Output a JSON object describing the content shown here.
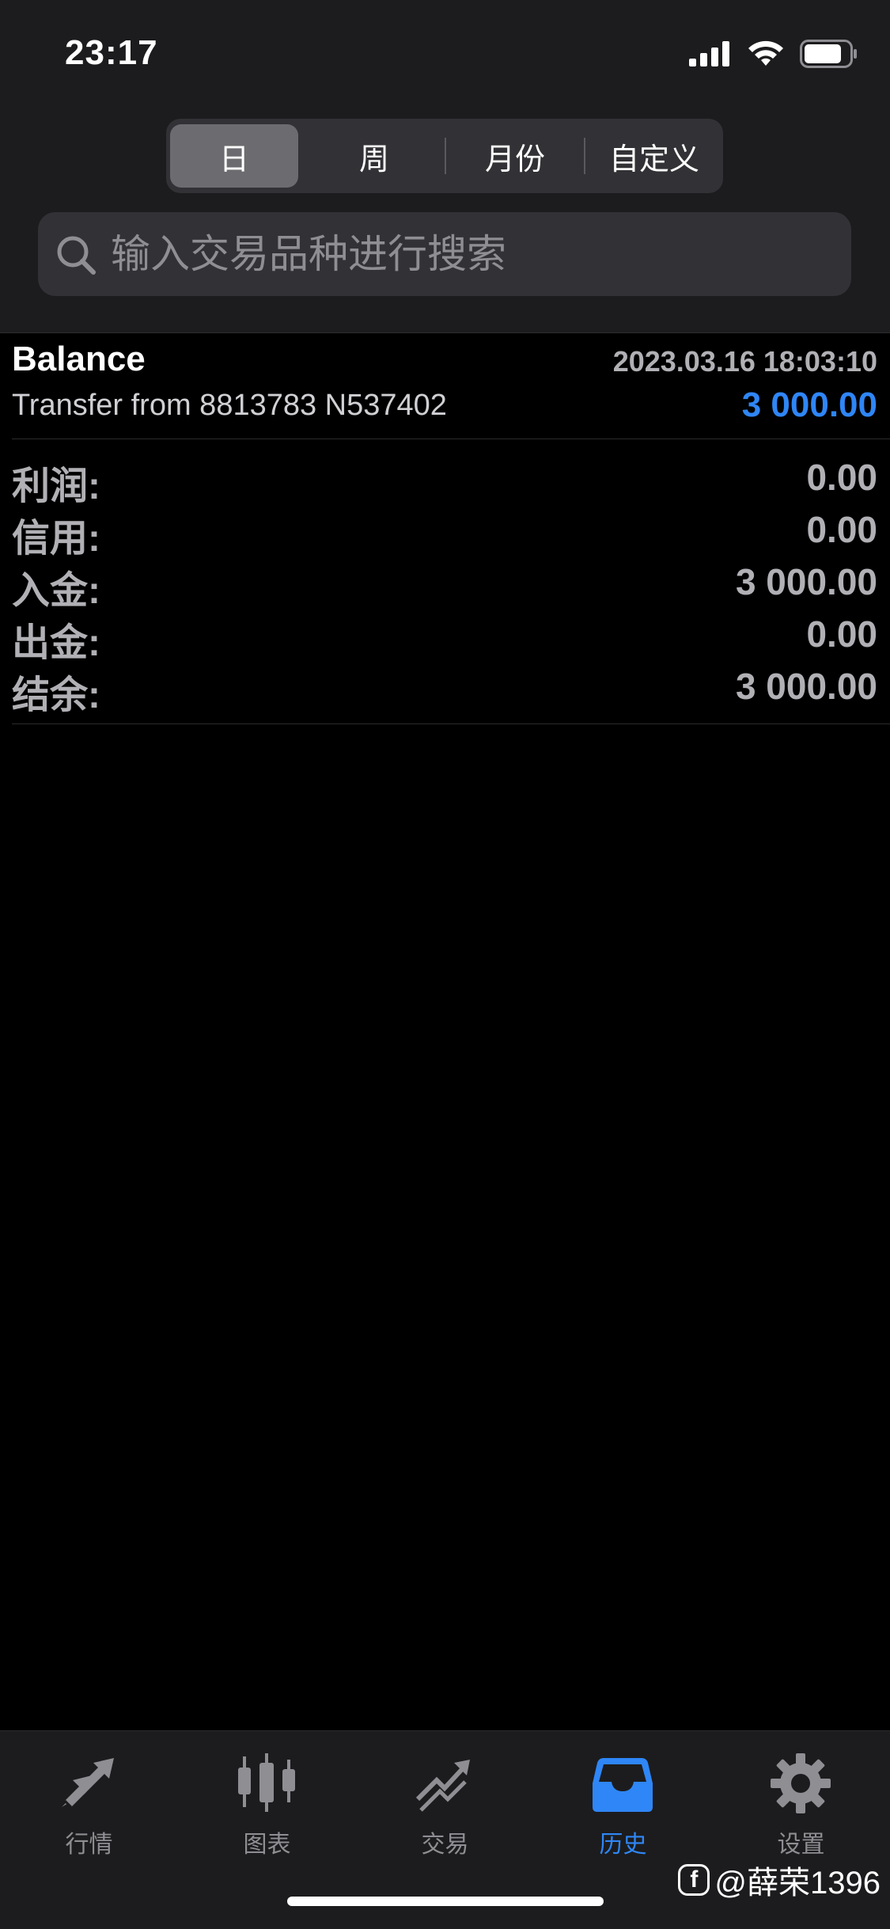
{
  "status_bar": {
    "time": "23:17"
  },
  "segmented": {
    "items": [
      {
        "label": "日",
        "active": true
      },
      {
        "label": "周",
        "active": false
      },
      {
        "label": "月份",
        "active": false
      },
      {
        "label": "自定义",
        "active": false
      }
    ]
  },
  "search": {
    "placeholder": "输入交易品种进行搜索",
    "value": ""
  },
  "deal": {
    "type": "Balance",
    "time": "2023.03.16 18:03:10",
    "comment": "Transfer from 8813783 N537402",
    "amount": "3 000.00"
  },
  "summary": [
    {
      "label": "利润:",
      "value": "0.00"
    },
    {
      "label": "信用:",
      "value": "0.00"
    },
    {
      "label": "入金:",
      "value": "3 000.00"
    },
    {
      "label": "出金:",
      "value": "0.00"
    },
    {
      "label": "结余:",
      "value": "3 000.00"
    }
  ],
  "tabs": [
    {
      "label": "行情",
      "icon": "quotes-icon",
      "active": false
    },
    {
      "label": "图表",
      "icon": "chart-icon",
      "active": false
    },
    {
      "label": "交易",
      "icon": "trade-icon",
      "active": false
    },
    {
      "label": "历史",
      "icon": "history-icon",
      "active": true
    },
    {
      "label": "设置",
      "icon": "settings-icon",
      "active": false
    }
  ],
  "watermark": {
    "text": "@薛荣1396",
    "logo_letter": "f"
  },
  "colors": {
    "accent": "#2f86f6",
    "panel": "#1c1c1e",
    "muted": "#8e8e93"
  }
}
